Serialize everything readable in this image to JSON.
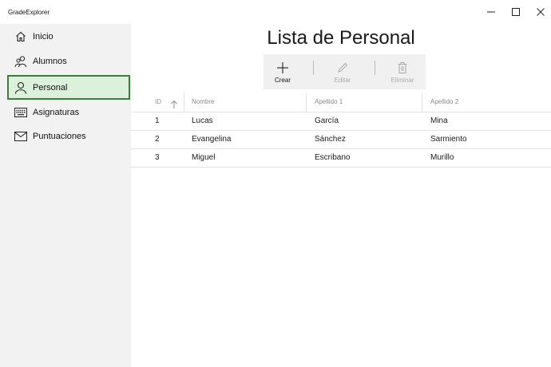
{
  "app": {
    "title": "GradeExplorer"
  },
  "window_controls": {
    "minimize_icon": "minimize-icon",
    "maximize_icon": "maximize-icon",
    "close_icon": "close-icon"
  },
  "sidebar": {
    "items": [
      {
        "label": "Inicio",
        "icon": "home-icon",
        "selected": false
      },
      {
        "label": "Alumnos",
        "icon": "people-icon",
        "selected": false
      },
      {
        "label": "Personal",
        "icon": "person-icon",
        "selected": true
      },
      {
        "label": "Asignaturas",
        "icon": "keyboard-icon",
        "selected": false
      },
      {
        "label": "Puntuaciones",
        "icon": "mail-icon",
        "selected": false
      }
    ],
    "selected_color": "#dbf1dc",
    "selected_border": "#3a7d3c"
  },
  "main": {
    "title": "Lista de Personal",
    "toolbar": {
      "create_label": "Crear",
      "edit_label": "Editar",
      "delete_label": "Eliminar"
    },
    "table": {
      "columns": [
        "ID",
        "Nombre",
        "Apellido 1",
        "Apellido 2"
      ],
      "sort_icon": "sort-ascending-icon",
      "rows": [
        {
          "id": "1",
          "nombre": "Lucas",
          "apellido1": "García",
          "apellido2": "Mina"
        },
        {
          "id": "2",
          "nombre": "Evangelina",
          "apellido1": "Sánchez",
          "apellido2": "Sarmiento"
        },
        {
          "id": "3",
          "nombre": "Miguel",
          "apellido1": "Escribano",
          "apellido2": "Murillo"
        }
      ]
    }
  }
}
